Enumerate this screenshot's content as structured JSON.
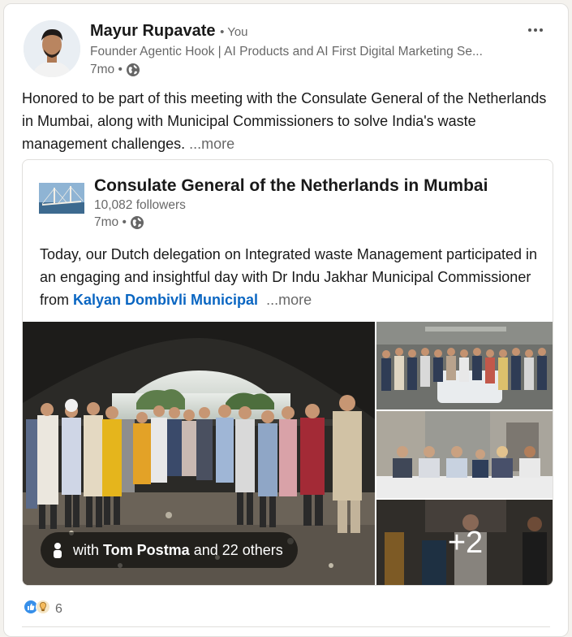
{
  "post": {
    "author_name": "Mayur Rupavate",
    "author_badge": "• You",
    "author_headline": "Founder Agentic Hook | AI Products and AI First Digital Marketing Se...",
    "time": "7mo •",
    "text": "Honored to be part of this meeting with the Consulate General of the Netherlands in Mumbai, along with Municipal Commissioners to solve India's waste management challenges. ",
    "see_more": "...more"
  },
  "reshared": {
    "org_name": "Consulate General of the Netherlands in Mumbai",
    "followers": "10,082 followers",
    "time": "7mo •",
    "text": "Today, our Dutch delegation on Integrated waste Management participated in an engaging and insightful day with Dr Indu Jakhar Municipal Commissioner from ",
    "mention": "Kalyan Dombivli Municipal",
    "see_more": "...more"
  },
  "media": {
    "tag_prefix": "with ",
    "tag_name": "Tom Postma",
    "tag_suffix": " and 22 others",
    "extra_count": "+2"
  },
  "social": {
    "reaction_count": "6",
    "icons": [
      "like-icon",
      "insightful-icon"
    ]
  },
  "colors": {
    "link_blue": "#0a66c2",
    "like_blue": "#378fe9",
    "insightful_yellow": "#f5bb5c"
  }
}
